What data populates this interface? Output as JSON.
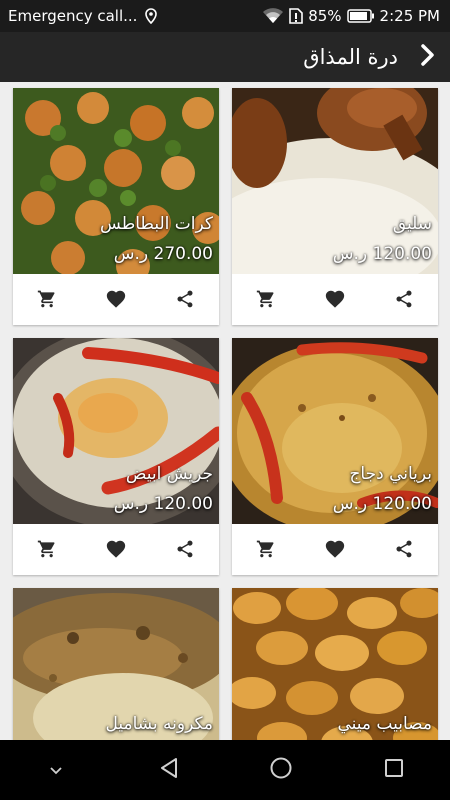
{
  "status_bar": {
    "carrier_text": "Emergency call...",
    "battery": "85%",
    "time": "2:25 PM"
  },
  "app_bar": {
    "title": "درة المذاق"
  },
  "currency": "ر.س",
  "products": [
    {
      "name": "سليق",
      "price": "120.00 ر.س"
    },
    {
      "name": "كرات البطاطس",
      "price": "270.00 ر.س"
    },
    {
      "name": "برياني دجاج",
      "price": "120.00 ر.س"
    },
    {
      "name": "جريش ابيض",
      "price": "120.00 ر.س"
    },
    {
      "name": "مصابيب ميني",
      "price": ""
    },
    {
      "name": "مكرونه بشاميل",
      "price": ""
    }
  ],
  "icons": {
    "cart": "cart-icon",
    "favorite": "heart-icon",
    "share": "share-icon",
    "back": "chevron-right-icon"
  },
  "colors": {
    "app_bar": "#262626",
    "status_bar": "#1b1b1b",
    "background": "#eeeeee",
    "action_icons": "#2b2b2b"
  }
}
